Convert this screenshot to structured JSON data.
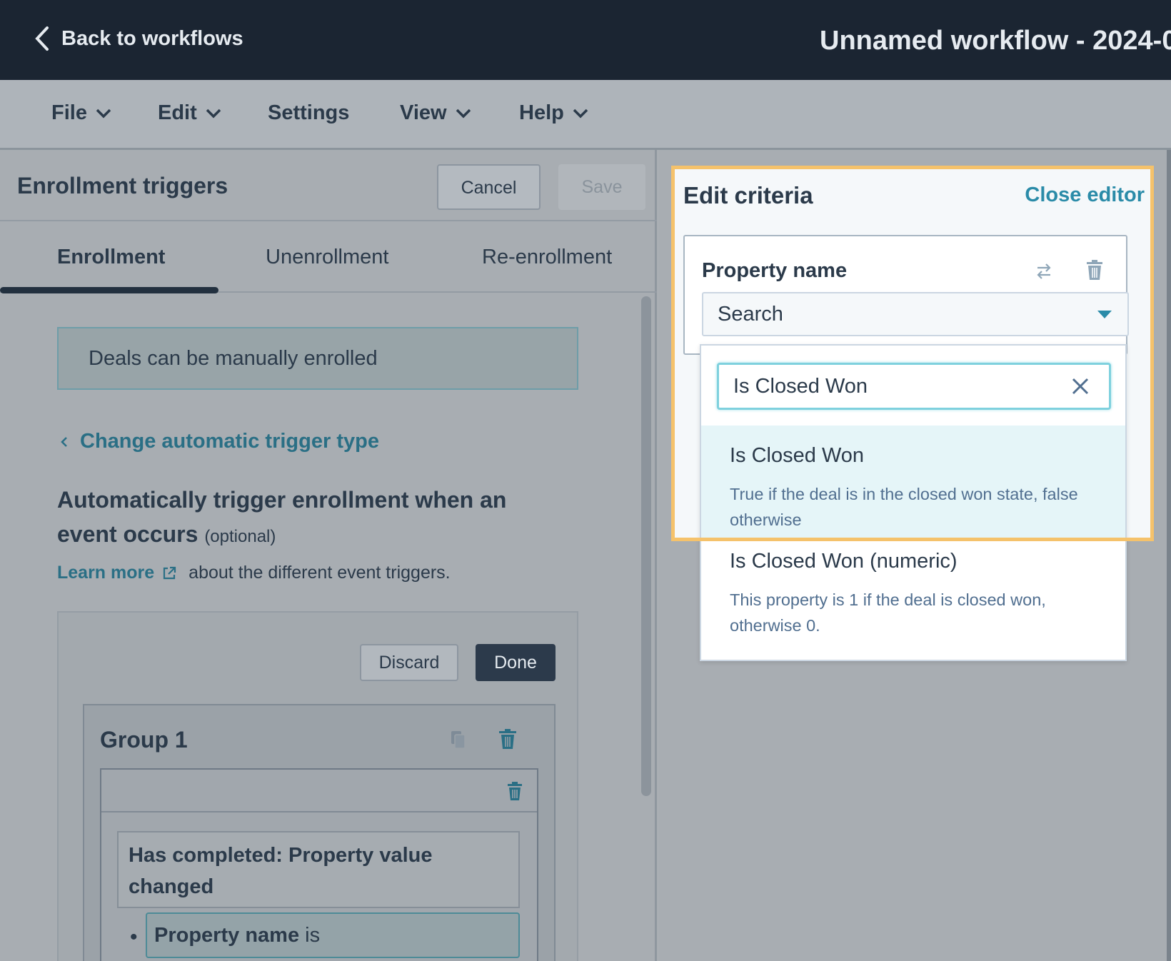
{
  "topbar": {
    "back_label": "Back to workflows",
    "workflow_title": "Unnamed workflow - 2024-0"
  },
  "menu": {
    "file": "File",
    "edit": "Edit",
    "settings": "Settings",
    "view": "View",
    "help": "Help"
  },
  "left_panel": {
    "title": "Enrollment triggers",
    "cancel": "Cancel",
    "save": "Save",
    "tabs": [
      "Enrollment",
      "Unenrollment",
      "Re-enrollment"
    ],
    "info_banner": "Deals can be manually enrolled",
    "change_trigger_link": "Change automatic trigger type",
    "auto_heading": "Automatically trigger enrollment when an event occurs",
    "optional_label": "(optional)",
    "learn_more": "Learn more",
    "learn_more_suffix": "about the different event triggers.",
    "discard": "Discard",
    "done": "Done",
    "group_title": "Group 1",
    "completed_text": "Has completed: Property value changed",
    "chip_bold": "Property name",
    "chip_rest": " is"
  },
  "edit_panel": {
    "title": "Edit criteria",
    "close_editor": "Close editor",
    "property_label": "Property name",
    "select_value": "Search",
    "search_value": "Is Closed Won",
    "options": [
      {
        "title": "Is Closed Won",
        "description": "True if the deal is in the closed won state, false otherwise"
      },
      {
        "title": "Is Closed Won (numeric)",
        "description": "This property is 1 if the deal is closed won, otherwise 0."
      }
    ]
  },
  "icons": {
    "back": "chevron-left-icon",
    "menu_caret": "chevron-down-icon",
    "external": "external-link-icon",
    "copy": "copy-icon",
    "trash": "trash-icon",
    "swap": "swap-icon",
    "clear": "close-icon",
    "select_caret": "caret-down-icon"
  },
  "colors": {
    "topbar": "#1b2532",
    "link": "#2a6f85",
    "highlight": "#f5c26b",
    "accent": "#2a8ba8"
  }
}
